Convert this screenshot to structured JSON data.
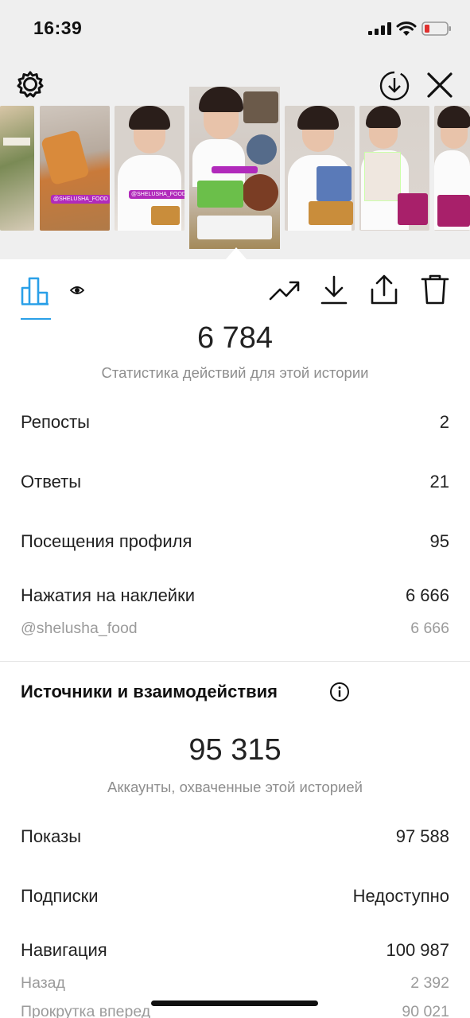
{
  "status_bar": {
    "time": "16:39"
  },
  "stories": {
    "tags": [
      "@SHELUSHA_FOOD",
      "@SHELUSHA_FOOD"
    ]
  },
  "metrics": {
    "actions_total": "6 784",
    "actions_caption": "Статистика действий для этой истории",
    "rows": [
      {
        "label": "Репосты",
        "value": "2"
      },
      {
        "label": "Ответы",
        "value": "21"
      },
      {
        "label": "Посещения профиля",
        "value": "95"
      },
      {
        "label": "Нажатия на наклейки",
        "value": "6 666"
      }
    ],
    "sticker_sub": {
      "label": "@shelusha_food",
      "value": "6 666"
    }
  },
  "discovery": {
    "title": "Источники и взаимодействия",
    "reach_total": "95 315",
    "reach_caption": "Аккаунты, охваченные этой историей",
    "rows": [
      {
        "label": "Показы",
        "value": "97 588"
      },
      {
        "label": "Подписки",
        "value": "Недоступно"
      },
      {
        "label": "Навигация",
        "value": "100 987"
      }
    ],
    "sub_rows": [
      {
        "label": "Назад",
        "value": "2 392"
      },
      {
        "label": "Прокрутка вперед",
        "value": "90 021"
      }
    ]
  },
  "colors": {
    "accent": "#2aa0e8",
    "tag": "#b12abb",
    "top_bg": "#efefef"
  }
}
